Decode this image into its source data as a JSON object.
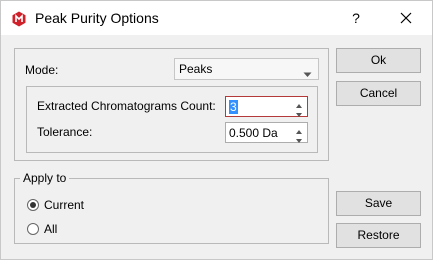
{
  "window": {
    "title": "Peak Purity Options",
    "help_label": "?",
    "app_icon": "app-logo-icon",
    "close_icon": "close-icon",
    "accent_color": "#d0202a"
  },
  "mode": {
    "label": "Mode:",
    "selected": "Peaks"
  },
  "fields": {
    "count_label": "Extracted Chromatograms Count:",
    "count_value": "3",
    "tolerance_label": "Tolerance:",
    "tolerance_value": "0.500 Da"
  },
  "apply_to": {
    "legend": "Apply to",
    "options": [
      {
        "label": "Current",
        "checked": true
      },
      {
        "label": "All",
        "checked": false
      }
    ]
  },
  "buttons": {
    "ok": "Ok",
    "cancel": "Cancel",
    "save": "Save",
    "restore": "Restore"
  }
}
